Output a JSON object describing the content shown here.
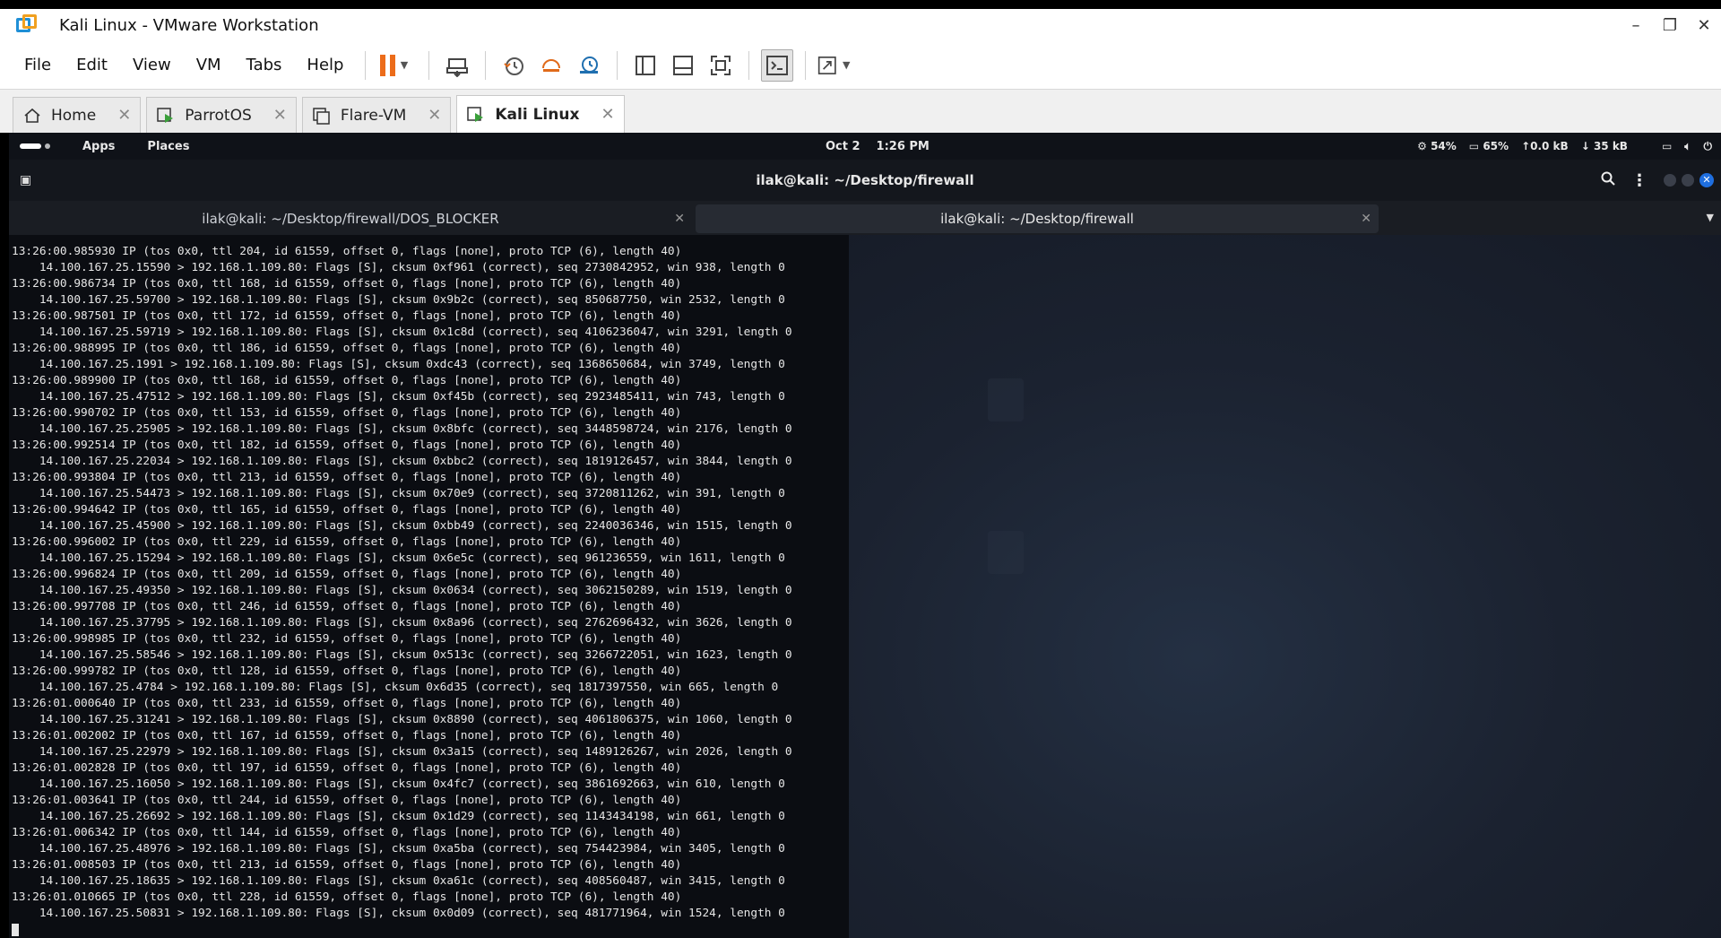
{
  "window": {
    "title": "Kali Linux - VMware Workstation",
    "controls": [
      "–",
      "❐",
      "✕"
    ]
  },
  "menu": {
    "items": [
      "File",
      "Edit",
      "View",
      "VM",
      "Tabs",
      "Help"
    ]
  },
  "toolbar": {
    "icons": [
      "pause-icon",
      "send-keys-icon",
      "snapshot-icon",
      "revert-snapshot-icon",
      "snapshot-manager-icon",
      "library-icon",
      "thumbnail-icon",
      "fullscreen-icon",
      "console-icon",
      "unity-icon"
    ]
  },
  "tabs": [
    {
      "label": "Home",
      "active": false
    },
    {
      "label": "ParrotOS",
      "active": false
    },
    {
      "label": "Flare-VM",
      "active": false
    },
    {
      "label": "Kali Linux",
      "active": true
    }
  ],
  "kali_panel": {
    "apps": "Apps",
    "places": "Places",
    "date": "Oct 2",
    "time": "1:26 PM",
    "cpu": "54%",
    "mem": "65%",
    "upload": "0.0 kB",
    "download": "35 kB"
  },
  "terminal": {
    "window_title": "ilak@kali: ~/Desktop/firewall",
    "tabs": [
      {
        "label": "ilak@kali: ~/Desktop/firewall/DOS_BLOCKER",
        "active": false
      },
      {
        "label": "ilak@kali: ~/Desktop/firewall",
        "active": true
      }
    ],
    "lines": [
      "13:26:00.985930 IP (tos 0x0, ttl 204, id 61559, offset 0, flags [none], proto TCP (6), length 40)",
      "    14.100.167.25.15590 > 192.168.1.109.80: Flags [S], cksum 0xf961 (correct), seq 2730842952, win 938, length 0",
      "13:26:00.986734 IP (tos 0x0, ttl 168, id 61559, offset 0, flags [none], proto TCP (6), length 40)",
      "    14.100.167.25.59700 > 192.168.1.109.80: Flags [S], cksum 0x9b2c (correct), seq 850687750, win 2532, length 0",
      "13:26:00.987501 IP (tos 0x0, ttl 172, id 61559, offset 0, flags [none], proto TCP (6), length 40)",
      "    14.100.167.25.59719 > 192.168.1.109.80: Flags [S], cksum 0x1c8d (correct), seq 4106236047, win 3291, length 0",
      "13:26:00.988995 IP (tos 0x0, ttl 186, id 61559, offset 0, flags [none], proto TCP (6), length 40)",
      "    14.100.167.25.1991 > 192.168.1.109.80: Flags [S], cksum 0xdc43 (correct), seq 1368650684, win 3749, length 0",
      "13:26:00.989900 IP (tos 0x0, ttl 168, id 61559, offset 0, flags [none], proto TCP (6), length 40)",
      "    14.100.167.25.47512 > 192.168.1.109.80: Flags [S], cksum 0xf45b (correct), seq 2923485411, win 743, length 0",
      "13:26:00.990702 IP (tos 0x0, ttl 153, id 61559, offset 0, flags [none], proto TCP (6), length 40)",
      "    14.100.167.25.25905 > 192.168.1.109.80: Flags [S], cksum 0x8bfc (correct), seq 3448598724, win 2176, length 0",
      "13:26:00.992514 IP (tos 0x0, ttl 182, id 61559, offset 0, flags [none], proto TCP (6), length 40)",
      "    14.100.167.25.22034 > 192.168.1.109.80: Flags [S], cksum 0xbbc2 (correct), seq 1819126457, win 3844, length 0",
      "13:26:00.993804 IP (tos 0x0, ttl 213, id 61559, offset 0, flags [none], proto TCP (6), length 40)",
      "    14.100.167.25.54473 > 192.168.1.109.80: Flags [S], cksum 0x70e9 (correct), seq 3720811262, win 391, length 0",
      "13:26:00.994642 IP (tos 0x0, ttl 165, id 61559, offset 0, flags [none], proto TCP (6), length 40)",
      "    14.100.167.25.45900 > 192.168.1.109.80: Flags [S], cksum 0xbb49 (correct), seq 2240036346, win 1515, length 0",
      "13:26:00.996002 IP (tos 0x0, ttl 229, id 61559, offset 0, flags [none], proto TCP (6), length 40)",
      "    14.100.167.25.15294 > 192.168.1.109.80: Flags [S], cksum 0x6e5c (correct), seq 961236559, win 1611, length 0",
      "13:26:00.996824 IP (tos 0x0, ttl 209, id 61559, offset 0, flags [none], proto TCP (6), length 40)",
      "    14.100.167.25.49350 > 192.168.1.109.80: Flags [S], cksum 0x0634 (correct), seq 3062150289, win 1519, length 0",
      "13:26:00.997708 IP (tos 0x0, ttl 246, id 61559, offset 0, flags [none], proto TCP (6), length 40)",
      "    14.100.167.25.37795 > 192.168.1.109.80: Flags [S], cksum 0x8a96 (correct), seq 2762696432, win 3626, length 0",
      "13:26:00.998985 IP (tos 0x0, ttl 232, id 61559, offset 0, flags [none], proto TCP (6), length 40)",
      "    14.100.167.25.58546 > 192.168.1.109.80: Flags [S], cksum 0x513c (correct), seq 3266722051, win 1623, length 0",
      "13:26:00.999782 IP (tos 0x0, ttl 128, id 61559, offset 0, flags [none], proto TCP (6), length 40)",
      "    14.100.167.25.4784 > 192.168.1.109.80: Flags [S], cksum 0x6d35 (correct), seq 1817397550, win 665, length 0",
      "13:26:01.000640 IP (tos 0x0, ttl 233, id 61559, offset 0, flags [none], proto TCP (6), length 40)",
      "    14.100.167.25.31241 > 192.168.1.109.80: Flags [S], cksum 0x8890 (correct), seq 4061806375, win 1060, length 0",
      "13:26:01.002002 IP (tos 0x0, ttl 167, id 61559, offset 0, flags [none], proto TCP (6), length 40)",
      "    14.100.167.25.22979 > 192.168.1.109.80: Flags [S], cksum 0x3a15 (correct), seq 1489126267, win 2026, length 0",
      "13:26:01.002828 IP (tos 0x0, ttl 197, id 61559, offset 0, flags [none], proto TCP (6), length 40)",
      "    14.100.167.25.16050 > 192.168.1.109.80: Flags [S], cksum 0x4fc7 (correct), seq 3861692663, win 610, length 0",
      "13:26:01.003641 IP (tos 0x0, ttl 244, id 61559, offset 0, flags [none], proto TCP (6), length 40)",
      "    14.100.167.25.26692 > 192.168.1.109.80: Flags [S], cksum 0x1d29 (correct), seq 1143434198, win 661, length 0",
      "13:26:01.006342 IP (tos 0x0, ttl 144, id 61559, offset 0, flags [none], proto TCP (6), length 40)",
      "    14.100.167.25.48976 > 192.168.1.109.80: Flags [S], cksum 0xa5ba (correct), seq 754423984, win 3405, length 0",
      "13:26:01.008503 IP (tos 0x0, ttl 213, id 61559, offset 0, flags [none], proto TCP (6), length 40)",
      "    14.100.167.25.18635 > 192.168.1.109.80: Flags [S], cksum 0xa61c (correct), seq 408560487, win 3415, length 0",
      "13:26:01.010665 IP (tos 0x0, ttl 228, id 61559, offset 0, flags [none], proto TCP (6), length 40)",
      "    14.100.167.25.50831 > 192.168.1.109.80: Flags [S], cksum 0x0d09 (correct), seq 481771964, win 1524, length 0"
    ]
  },
  "colors": {
    "accent_orange": "#ec6c1a",
    "vmware_blue": "#1f8fd6",
    "terminal_bg": "#0b0d12",
    "kali_blue": "#1f6fe0"
  }
}
